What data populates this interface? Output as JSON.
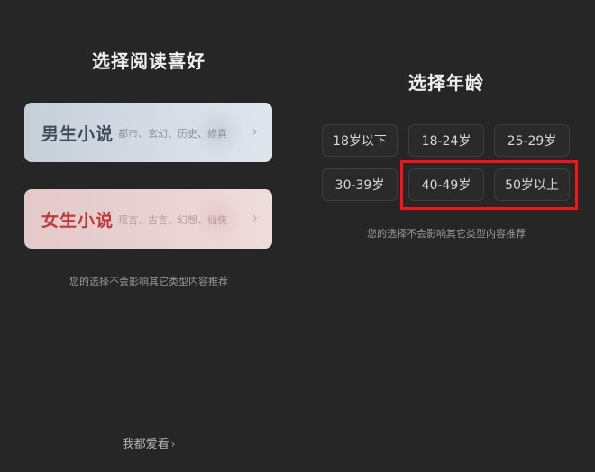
{
  "left_panel": {
    "title": "选择阅读喜好",
    "genres": [
      {
        "name": "男生小说",
        "subtitle": "都市、玄幻、历史、修真",
        "chevron": "›"
      },
      {
        "name": "女生小说",
        "subtitle": "现言、古言、幻想、仙侠",
        "chevron": "›"
      }
    ],
    "note": "您的选择不会影响其它类型内容推荐",
    "love_all_label": "我都爱看",
    "love_all_chevron": "›"
  },
  "right_panel": {
    "title": "选择年龄",
    "age_options": [
      "18岁以下",
      "18-24岁",
      "25-29岁",
      "30-39岁",
      "40-49岁",
      "50岁以上"
    ],
    "note": "您的选择不会影响其它类型内容推荐"
  },
  "colors": {
    "background": "#262626",
    "male_card": "#d3dae3",
    "female_card": "#e9d1d1",
    "male_text": "#3e4b5c",
    "female_text": "#c0393d",
    "highlight": "#d2232a"
  }
}
